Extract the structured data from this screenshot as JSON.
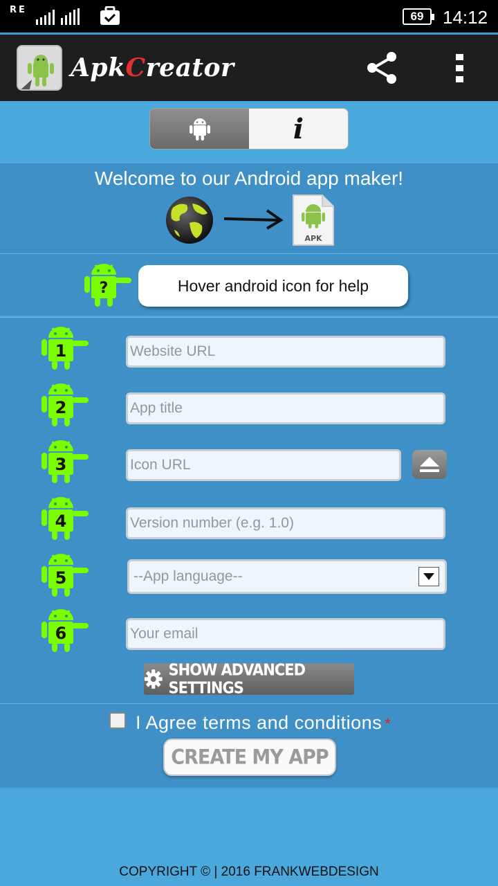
{
  "status_bar": {
    "network_label": "RE",
    "battery": "69",
    "time": "14:12"
  },
  "app_bar": {
    "title_part1": "Apk",
    "title_part2": "C",
    "title_part3": "reator",
    "share_icon": "share-icon",
    "more_icon": "more-vert-icon"
  },
  "mode_toggle": {
    "android_icon": "android-icon",
    "info_label": "i"
  },
  "welcome": {
    "text": "Welcome to our Android app maker!",
    "apk_label": "APK"
  },
  "help": {
    "bot_label": "?",
    "text": "Hover android icon for help"
  },
  "form": {
    "steps": [
      "1",
      "2",
      "3",
      "4",
      "5",
      "6"
    ],
    "website_url_placeholder": "Website URL",
    "app_title_placeholder": "App title",
    "icon_url_placeholder": "Icon URL",
    "version_placeholder": "Version number (e.g. 1.0)",
    "language_selected": "--App language--",
    "email_placeholder": "Your email",
    "advanced_label": "SHOW ADVANCED SETTINGS"
  },
  "terms": {
    "label": "I Agree terms and conditions",
    "required_mark": "*",
    "checked": false
  },
  "create_button": "CREATE MY APP",
  "footer": "COPYRIGHT © | 2016 FRANKWEBDESIGN",
  "colors": {
    "background": "#4aa8dd",
    "band": "#3f90c6",
    "app_bar": "#1e1e1e",
    "android_green": "#7cfc00",
    "required": "#e02020"
  }
}
